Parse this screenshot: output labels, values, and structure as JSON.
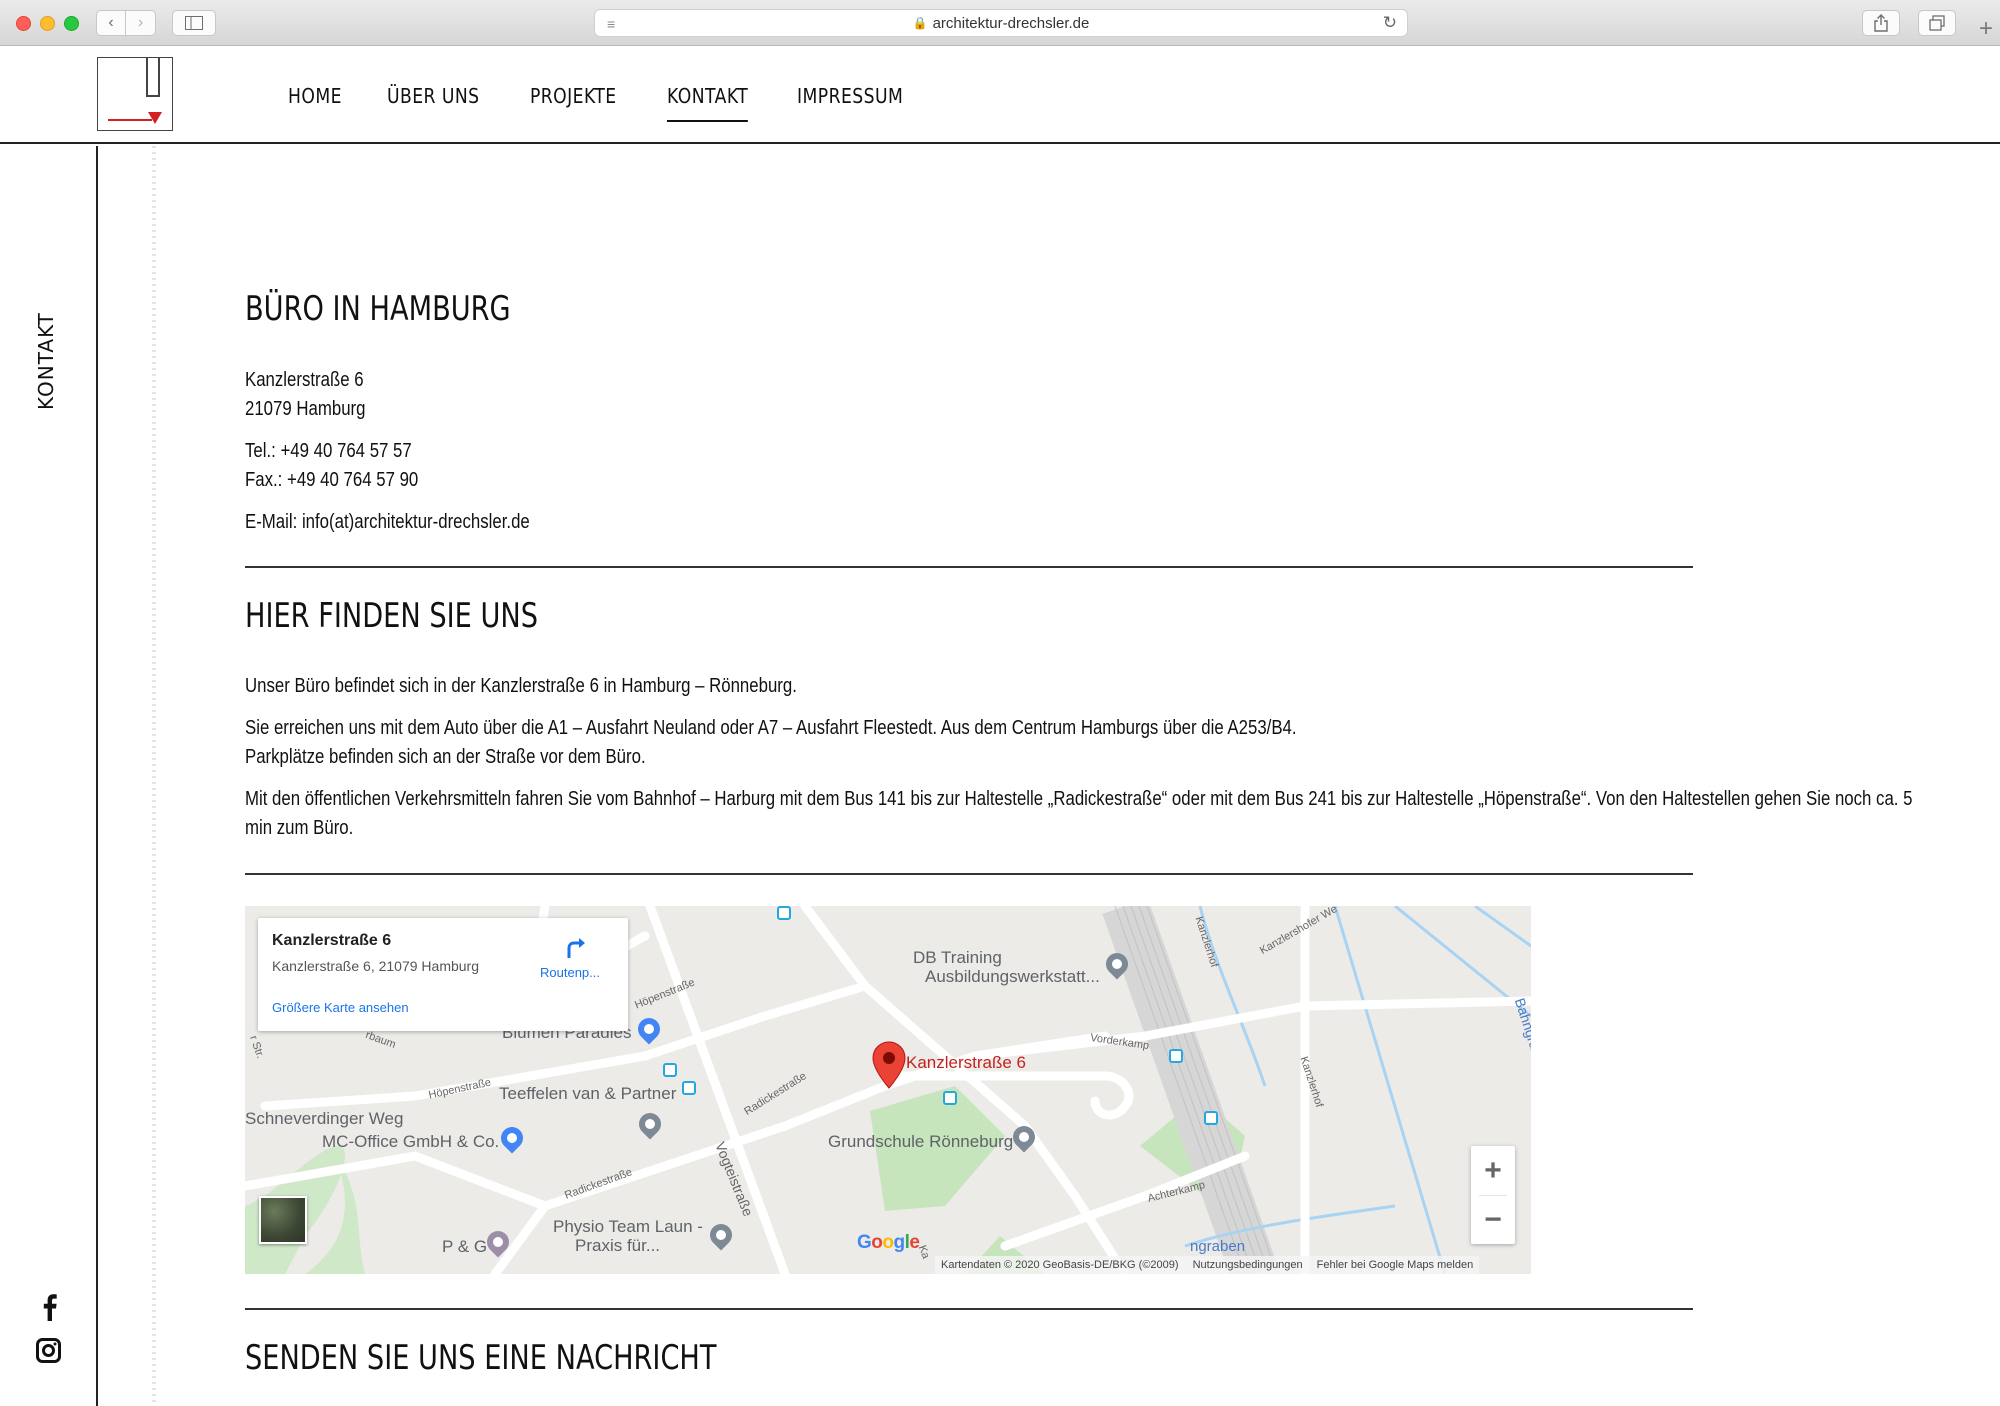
{
  "browser": {
    "url": "architektur-drechsler.de"
  },
  "nav": {
    "items": [
      {
        "label": "HOME"
      },
      {
        "label": "ÜBER UNS"
      },
      {
        "label": "PROJEKTE"
      },
      {
        "label": "KONTAKT",
        "active": true
      },
      {
        "label": "IMPRESSUM"
      }
    ]
  },
  "sidebar": {
    "page_label": "KONTAKT",
    "social": [
      "facebook-icon",
      "instagram-icon"
    ]
  },
  "office": {
    "heading": "BÜRO IN HAMBURG",
    "street": "Kanzlerstraße 6",
    "city": "21079 Hamburg",
    "tel": "Tel.: +49 40 764 57 57",
    "fax": "Fax.: +49 40 764 57 90",
    "email": "E-Mail: info(at)architektur-drechsler.de"
  },
  "directions": {
    "heading": "HIER FINDEN SIE UNS",
    "p1": "Unser Büro befindet sich in der Kanzlerstraße 6 in Hamburg – Rönneburg.",
    "p2a": "Sie erreichen uns mit dem Auto über die A1 – Ausfahrt Neuland oder A7 – Ausfahrt Fleestedt. Aus dem Centrum Hamburgs über die A253/B4.",
    "p2b": "Parkplätze befinden sich an der Straße vor dem Büro.",
    "p3a": "Mit den öffentlichen Verkehrsmitteln fahren Sie vom Bahnhof – Harburg mit dem Bus 141 bis zur Haltestelle „Radickestraße“ oder mit dem Bus 241 bis zur Haltestelle „Höpenstraße“. Von den Haltestellen gehen Sie noch ca. 5",
    "p3b": "min zum Büro."
  },
  "map": {
    "card_title": "Kanzlerstraße 6",
    "card_address": "Kanzlerstraße 6, 21079 Hamburg",
    "card_larger_map": "Größere Karte ansehen",
    "card_route": "Routenp...",
    "marker_label": "Kanzlerstraße 6",
    "places": {
      "db_training_1": "DB Training",
      "db_training_2": "Ausbildungswerkstatt...",
      "blumen": "Blumen Paradies",
      "teeffelen": "Teeffelen van & Partner",
      "schneverdinger": "Schneverdinger Weg",
      "mc_office": "MC-Office GmbH & Co.",
      "grundschule": "Grundschule Rönneburg",
      "physio_1": "Physio Team Laun -",
      "physio_2": "Praxis für...",
      "pg": "P & G"
    },
    "streets": {
      "hoepen1": "Höpenstraße",
      "hoepen2": "Höpenstraße",
      "radicke1": "Radickestraße",
      "radicke2": "Radickestraße",
      "vogtei": "Vogteistraße",
      "vorderkamp": "Vorderkamp",
      "achterkamp": "Achterkamp",
      "kanzlerhof1": "Kanzlerhof",
      "kanzlerhof2": "Kanzlerhof",
      "kanzlershofer": "Kanzlershofer We",
      "bahngraben": "Bahngraben Kanzlerhof",
      "graben": "ngraben",
      "str": "r Str.",
      "baum": "rbaum",
      "ka": "Ka"
    },
    "zoom_in": "+",
    "zoom_out": "−",
    "google": "Google",
    "attribution": "Kartendaten © 2020 GeoBasis-DE/BKG (©2009)",
    "terms": "Nutzungsbedingungen",
    "report": "Fehler bei Google Maps melden"
  },
  "message": {
    "heading": "SENDEN SIE UNS EINE NACHRICHT"
  },
  "colors": {
    "accent_red": "#d42020",
    "map_link_blue": "#1a73e8",
    "marker_red": "#ea4335"
  }
}
